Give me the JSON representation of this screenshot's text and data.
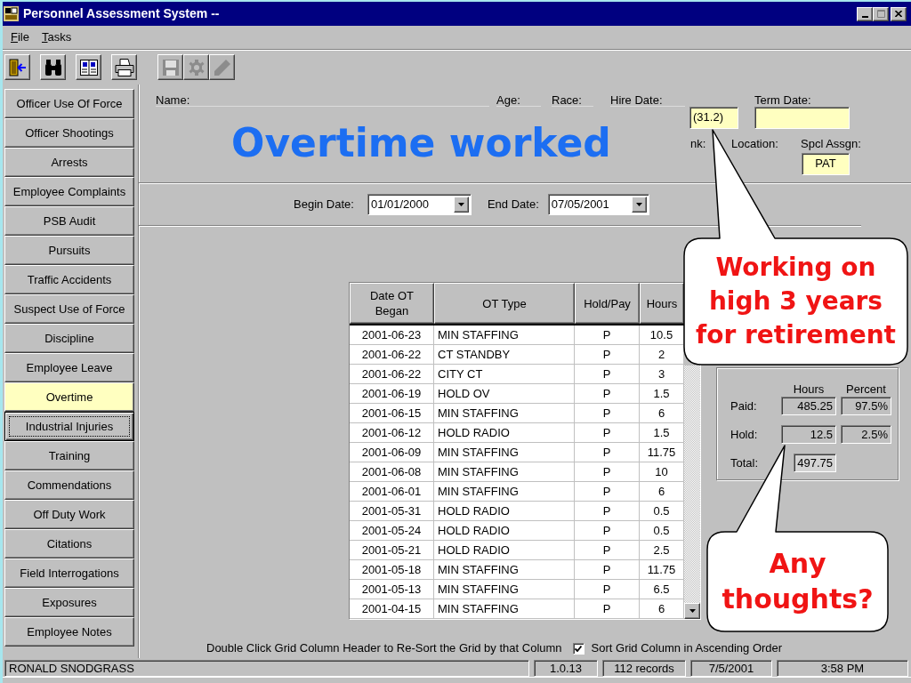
{
  "window": {
    "title": "Personnel Assessment System --"
  },
  "menu": [
    {
      "label": "File"
    },
    {
      "label": "Tasks"
    }
  ],
  "toolbar": {
    "groups": [
      {
        "buttons": [
          {
            "kind": "exit",
            "disabled": false
          },
          {
            "kind": "find",
            "disabled": false
          },
          {
            "kind": "book",
            "disabled": false
          },
          {
            "kind": "print",
            "disabled": false
          }
        ]
      },
      {
        "buttons": [
          {
            "kind": "save",
            "disabled": true
          },
          {
            "kind": "gear",
            "disabled": true
          },
          {
            "kind": "pencil",
            "disabled": true
          }
        ]
      }
    ]
  },
  "sidebar": {
    "items": [
      {
        "label": "Officer Use Of Force",
        "selected": false,
        "focused": false
      },
      {
        "label": "Officer Shootings",
        "selected": false,
        "focused": false
      },
      {
        "label": "Arrests",
        "selected": false,
        "focused": false
      },
      {
        "label": "Employee Complaints",
        "selected": false,
        "focused": false
      },
      {
        "label": "PSB Audit",
        "selected": false,
        "focused": false
      },
      {
        "label": "Pursuits",
        "selected": false,
        "focused": false
      },
      {
        "label": "Traffic Accidents",
        "selected": false,
        "focused": false
      },
      {
        "label": "Suspect Use of Force",
        "selected": false,
        "focused": false
      },
      {
        "label": "Discipline",
        "selected": false,
        "focused": false
      },
      {
        "label": "Employee Leave",
        "selected": false,
        "focused": false
      },
      {
        "label": "Overtime",
        "selected": true,
        "focused": false
      },
      {
        "label": "Industrial Injuries",
        "selected": false,
        "focused": true
      },
      {
        "label": "Training",
        "selected": false,
        "focused": false
      },
      {
        "label": "Commendations",
        "selected": false,
        "focused": false
      },
      {
        "label": "Off Duty Work",
        "selected": false,
        "focused": false
      },
      {
        "label": "Citations",
        "selected": false,
        "focused": false
      },
      {
        "label": "Field Interrogations",
        "selected": false,
        "focused": false
      },
      {
        "label": "Exposures",
        "selected": false,
        "focused": false
      },
      {
        "label": "Employee Notes",
        "selected": false,
        "focused": false
      }
    ]
  },
  "employee": {
    "name": {
      "label": "Name:"
    },
    "age": {
      "label": "Age:"
    },
    "race": {
      "label": "Race:"
    },
    "hire_date": {
      "label": "Hire Date:"
    },
    "hire_date_value": {
      "value": "(31.2)"
    },
    "term_date": {
      "label": "Term Date:"
    },
    "rank": {
      "label": "nk:"
    },
    "location": {
      "label": "Location:"
    },
    "special_assignment": {
      "label": "Spcl Assgn:",
      "value": "PAT"
    }
  },
  "page_title": "Overtime worked",
  "date_range": {
    "begin": {
      "label": "Begin Date:",
      "value": "01/01/2000"
    },
    "end": {
      "label": "End Date:",
      "value": "07/05/2001"
    }
  },
  "table": {
    "columns": [
      "Date OT Began",
      "OT Type",
      "Hold/Pay",
      "Hours"
    ],
    "rows": [
      {
        "date": "2001-06-23",
        "type": "MIN STAFFING",
        "hold_pay": "P",
        "hours": "10.5"
      },
      {
        "date": "2001-06-22",
        "type": "CT STANDBY",
        "hold_pay": "P",
        "hours": "2"
      },
      {
        "date": "2001-06-22",
        "type": "CITY CT",
        "hold_pay": "P",
        "hours": "3"
      },
      {
        "date": "2001-06-19",
        "type": "HOLD OV",
        "hold_pay": "P",
        "hours": "1.5"
      },
      {
        "date": "2001-06-15",
        "type": "MIN STAFFING",
        "hold_pay": "P",
        "hours": "6"
      },
      {
        "date": "2001-06-12",
        "type": "HOLD RADIO",
        "hold_pay": "P",
        "hours": "1.5"
      },
      {
        "date": "2001-06-09",
        "type": "MIN STAFFING",
        "hold_pay": "P",
        "hours": "11.75"
      },
      {
        "date": "2001-06-08",
        "type": "MIN STAFFING",
        "hold_pay": "P",
        "hours": "10"
      },
      {
        "date": "2001-06-01",
        "type": "MIN STAFFING",
        "hold_pay": "P",
        "hours": "6"
      },
      {
        "date": "2001-05-31",
        "type": "HOLD RADIO",
        "hold_pay": "P",
        "hours": "0.5"
      },
      {
        "date": "2001-05-24",
        "type": "HOLD RADIO",
        "hold_pay": "P",
        "hours": "0.5"
      },
      {
        "date": "2001-05-21",
        "type": "HOLD RADIO",
        "hold_pay": "P",
        "hours": "2.5"
      },
      {
        "date": "2001-05-18",
        "type": "MIN STAFFING",
        "hold_pay": "P",
        "hours": "11.75"
      },
      {
        "date": "2001-05-13",
        "type": "MIN STAFFING",
        "hold_pay": "P",
        "hours": "6.5"
      },
      {
        "date": "2001-04-15",
        "type": "MIN STAFFING",
        "hold_pay": "P",
        "hours": "6"
      }
    ]
  },
  "summary": {
    "columns": [
      "Hours",
      "Percent"
    ],
    "rows": [
      {
        "label": "Paid:",
        "hours": "485.25",
        "percent": "97.5%"
      },
      {
        "label": "Hold:",
        "hours": "12.5",
        "percent": "2.5%"
      },
      {
        "label": "Total:",
        "hours": "497.75"
      }
    ]
  },
  "hint": "Double Click Grid Column Header to Re-Sort the Grid by that Column",
  "sort_checkbox": {
    "label": "Sort Grid Column in Ascending Order",
    "checked": true
  },
  "status_bar": [
    "RONALD SNODGRASS",
    "1.0.13",
    "112 records",
    "7/5/2001",
    "3:58 PM"
  ],
  "callouts": [
    {
      "text": "Working on high 3 years for retirement"
    },
    {
      "text": "Any thoughts?"
    }
  ]
}
